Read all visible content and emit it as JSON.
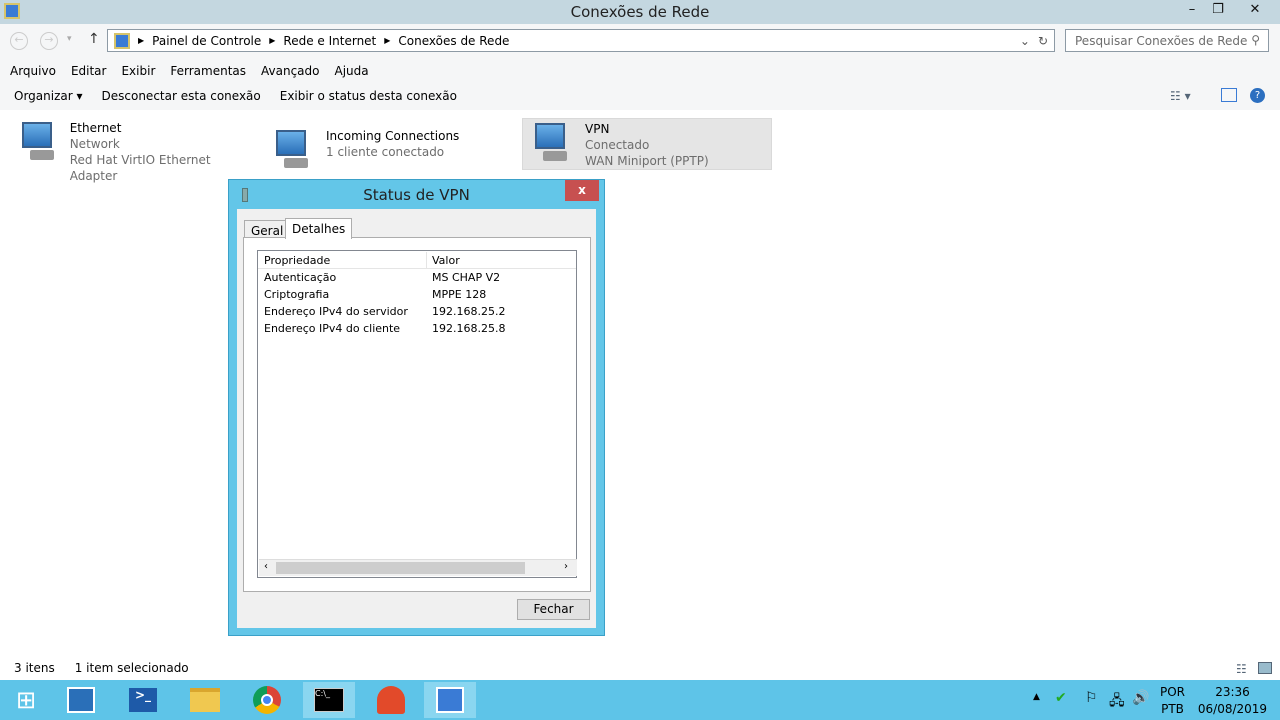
{
  "window": {
    "title": "Conexões de Rede",
    "minimize": "–",
    "restore": "❐",
    "close": "✕"
  },
  "breadcrumb": [
    "Painel de Controle",
    "Rede e Internet",
    "Conexões de Rede"
  ],
  "search": {
    "placeholder": "Pesquisar Conexões de Rede"
  },
  "menu": [
    "Arquivo",
    "Editar",
    "Exibir",
    "Ferramentas",
    "Avançado",
    "Ajuda"
  ],
  "toolbar": {
    "organize": "Organizar ▾",
    "disconnect": "Desconectar esta conexão",
    "status": "Exibir o status desta conexão"
  },
  "connections": [
    {
      "name": "Ethernet",
      "line2": "Network",
      "line3": "Red Hat VirtIO Ethernet Adapter"
    },
    {
      "name": "Incoming Connections",
      "line2": "1 cliente conectado",
      "line3": ""
    },
    {
      "name": "VPN",
      "line2": "Conectado",
      "line3": "WAN Miniport (PPTP)"
    }
  ],
  "statusbar": {
    "count": "3 itens",
    "selected": "1 item selecionado"
  },
  "dialog": {
    "title": "Status de VPN",
    "close": "x",
    "tabs": [
      "Geral",
      "Detalhes"
    ],
    "columns": [
      "Propriedade",
      "Valor"
    ],
    "rows": [
      [
        "Autenticação",
        "MS CHAP V2"
      ],
      [
        "Criptografia",
        "MPPE 128"
      ],
      [
        "Endereço IPv4 do servidor",
        "192.168.25.2"
      ],
      [
        "Endereço IPv4 do cliente",
        "192.168.25.8"
      ]
    ],
    "button": "Fechar"
  },
  "tray": {
    "lang1": "POR",
    "lang2": "PTB",
    "time": "23:36",
    "date": "06/08/2019"
  }
}
